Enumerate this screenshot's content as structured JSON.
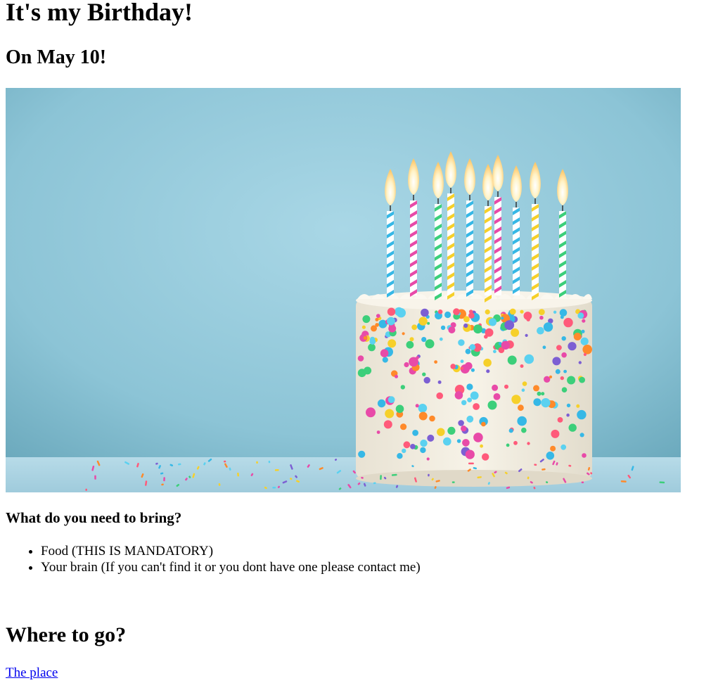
{
  "title": "It's my Birthday!",
  "date_heading": "On May 10!",
  "image": {
    "subject": "birthday-cake-with-candles",
    "colors": {
      "background": "#8fc4d6",
      "frosting": "#f4efe2",
      "table": "#a9d3e2"
    }
  },
  "bring": {
    "heading": "What do you need to bring?",
    "items": [
      "Food (THIS IS MANDATORY)",
      "Your brain (If you can't find it or you dont have one please contact me)"
    ]
  },
  "location": {
    "heading": "Where to go?",
    "link_text": "The place",
    "link_color": "#0000ee"
  }
}
